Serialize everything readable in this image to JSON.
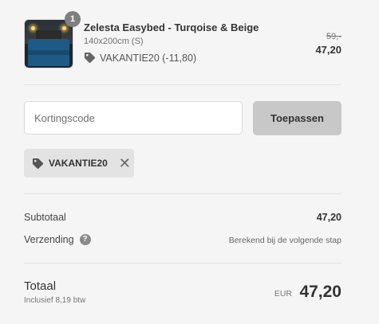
{
  "product": {
    "quantity": "1",
    "name": "Zelesta Easybed - Turqoise & Beige",
    "variant": "140x200cm (S)",
    "discount": "VAKANTIE20 (-11,80)",
    "old_price": "59,-",
    "price": "47,20",
    "icons": {
      "thumbnail": "bed-product-image",
      "discount": "tag-icon"
    }
  },
  "coupon": {
    "placeholder": "Kortingscode",
    "value": "",
    "apply_label": "Toepassen",
    "applied_code": "VAKANTIE20",
    "remove_icon": "close-icon"
  },
  "summary": {
    "subtotal_label": "Subtotaal",
    "subtotal_value": "47,20",
    "shipping_label": "Verzending",
    "shipping_help": "?",
    "shipping_value": "Berekend bij de volgende stap"
  },
  "total": {
    "label": "Totaal",
    "tax_note": "Inclusief 8,19 btw",
    "currency": "EUR",
    "amount": "47,20"
  },
  "colors": {
    "background": "#f5f5f5",
    "button": "#c8c8c8",
    "chip": "#e3e3e3",
    "badge": "#7f7f7f"
  }
}
